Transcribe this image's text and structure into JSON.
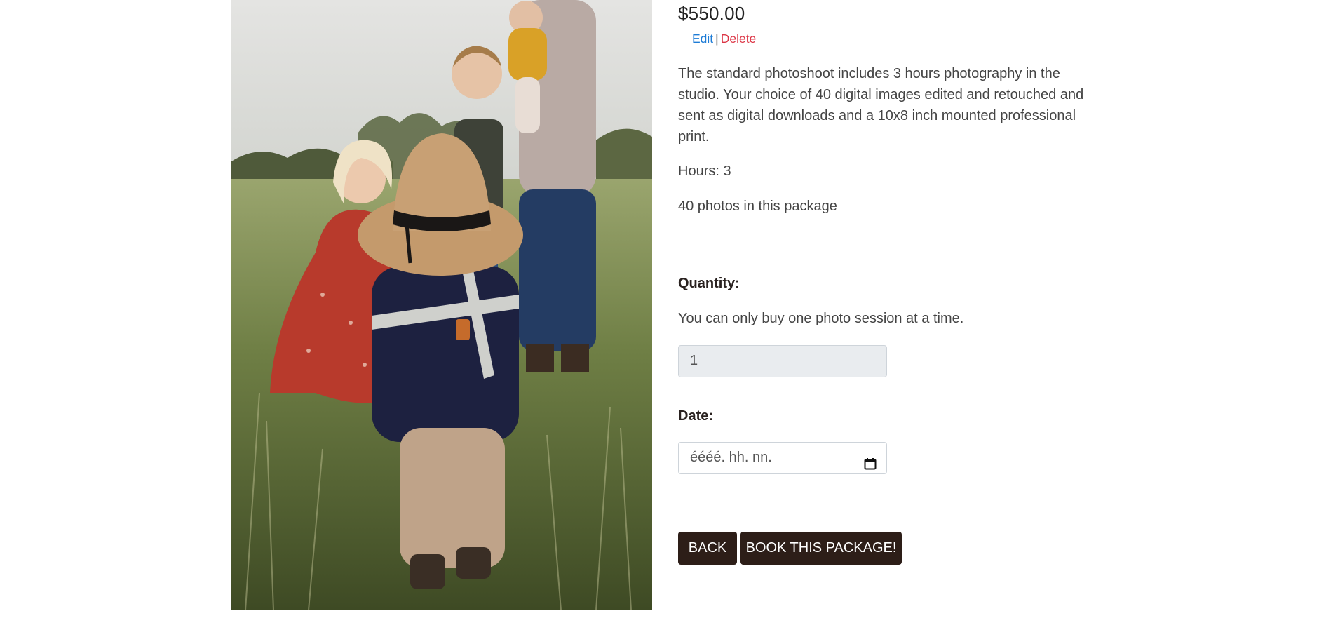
{
  "product": {
    "price": "$550.00",
    "description": "The standard photoshoot includes 3 hours photography in the studio. Your choice of 40 digital images edited and retouched and sent as digital downloads and a 10x8 inch mounted professional print.",
    "hours_text": "Hours: 3",
    "photos_text": "40 photos in this package",
    "image_icon": "family-photo"
  },
  "admin": {
    "edit_label": "Edit",
    "separator": "|",
    "delete_label": "Delete"
  },
  "form": {
    "quantity_label": "Quantity:",
    "quantity_note": "You can only buy one photo session at a time.",
    "quantity_value": "1",
    "date_label": "Date:",
    "date_placeholder": "éééé. hh. nn."
  },
  "buttons": {
    "back_label": "BACK",
    "book_label": "BOOK THIS PACKAGE!"
  },
  "colors": {
    "button_bg": "#2d1e18",
    "edit_link": "#1e7cd6",
    "delete_link": "#dc3545",
    "disabled_input_bg": "#e9ecef"
  }
}
